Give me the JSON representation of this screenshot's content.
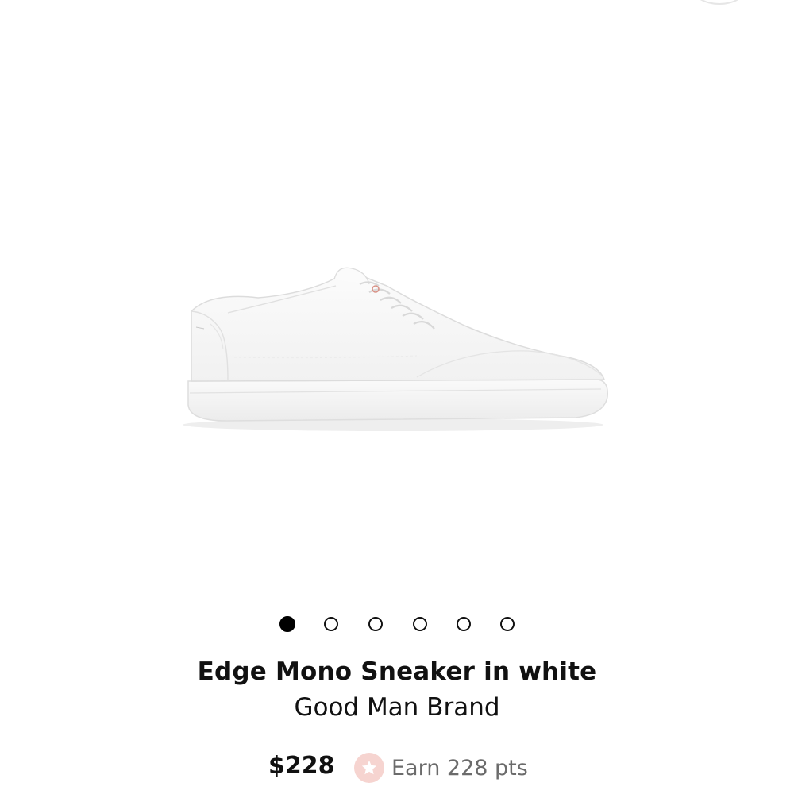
{
  "carousel": {
    "image_alt": "Edge Mono Sneaker in white",
    "dots_total": 6,
    "active_index": 0
  },
  "product": {
    "title": "Edge Mono Sneaker in white",
    "brand": "Good Man Brand",
    "price": "$228",
    "points_text": "Earn 228 pts"
  },
  "colors": {
    "accent_star_bg": "#f6d4d0",
    "muted_text": "#6b6b6b"
  },
  "icons": {
    "points": "star-icon"
  }
}
